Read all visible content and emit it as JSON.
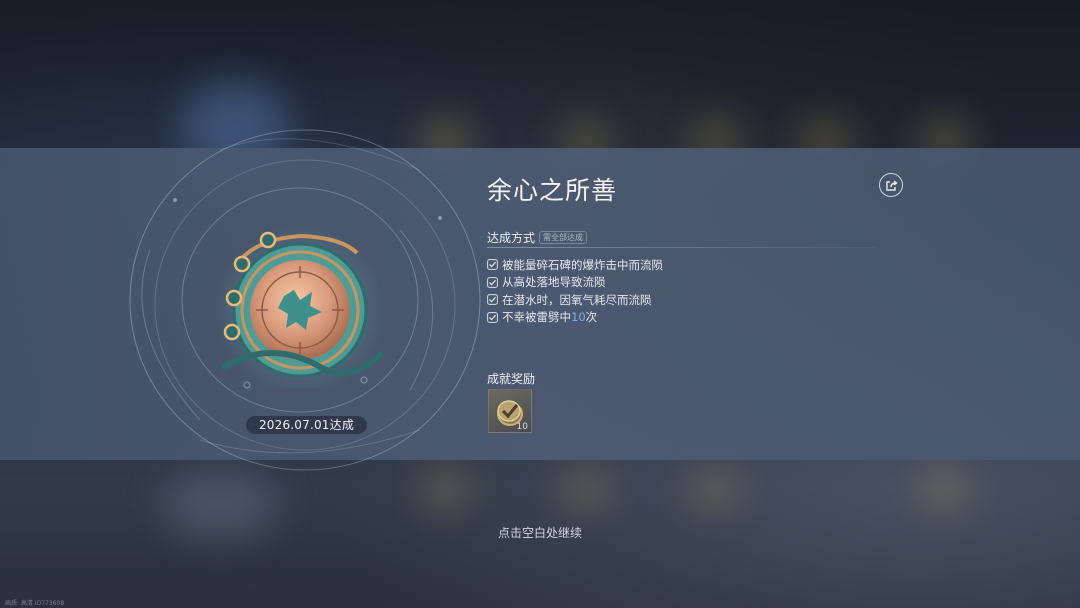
{
  "achievement": {
    "title": "余心之所善",
    "date_text": "2026.07.01达成"
  },
  "conditions": {
    "label": "达成方式",
    "tag": "需全部达成",
    "items": [
      {
        "text": "被能量碎石碑的爆炸击中而流陨"
      },
      {
        "text": "从高处落地导致流陨"
      },
      {
        "text": "在潜水时，因氧气耗尽而流陨"
      },
      {
        "text_before": "不幸被雷劈中",
        "highlight": "10",
        "text_after": "次"
      }
    ]
  },
  "reward": {
    "label": "成就奖励",
    "count": "10"
  },
  "footer": {
    "continue_hint": "点击空白处继续",
    "watermark": "画质: 高清 ID773608"
  },
  "icons": {
    "share": "share-icon",
    "check": "check-icon",
    "medal": "compass-medal-icon",
    "reward": "achievement-token-icon"
  },
  "colors": {
    "highlight": "#7fb0e6",
    "panel": "#4e5c74"
  }
}
